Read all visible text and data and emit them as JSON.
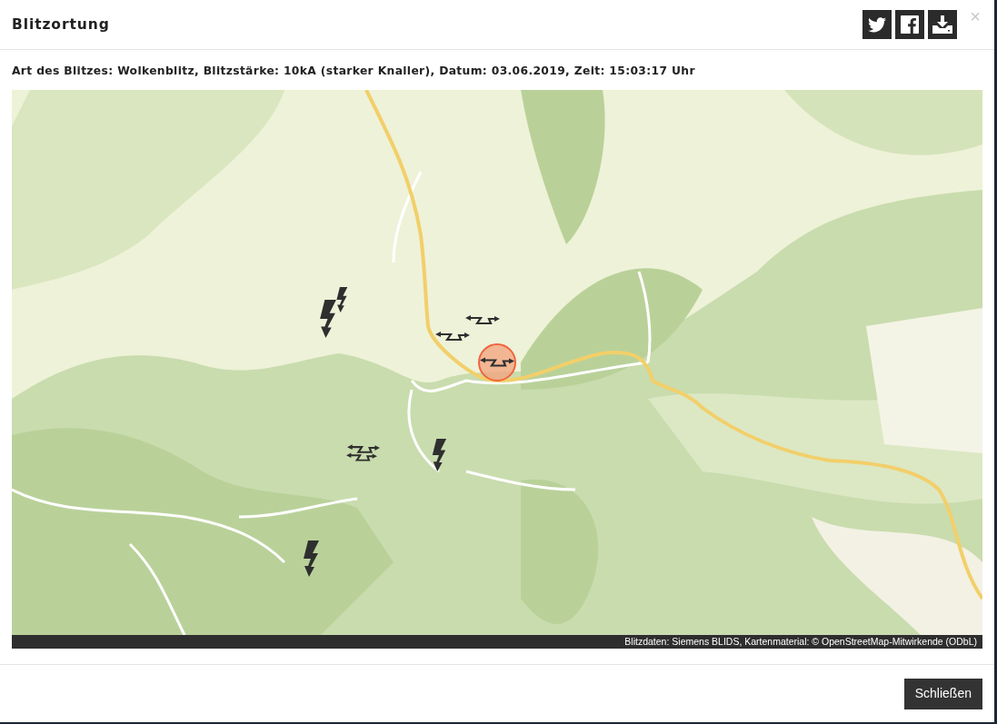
{
  "modal": {
    "title": "Blitzortung",
    "close": "×"
  },
  "share_buttons": [
    {
      "kind": "twitter"
    },
    {
      "kind": "facebook"
    },
    {
      "kind": "download"
    }
  ],
  "info": "Art des Blitzes: Wolkenblitz, Blitzstärke: 10kA (starker Knaller), Datum: 03.06.2019, Zeit: 15:03:17 Uhr",
  "map": {
    "strikes": [
      {
        "kind": "ground",
        "selected": false
      },
      {
        "kind": "ground",
        "selected": false
      },
      {
        "kind": "cloud",
        "selected": false
      },
      {
        "kind": "cloud",
        "selected": false
      },
      {
        "kind": "cloud",
        "selected": true
      },
      {
        "kind": "cloud",
        "selected": false
      },
      {
        "kind": "cloud",
        "selected": false
      },
      {
        "kind": "ground",
        "selected": false
      },
      {
        "kind": "ground",
        "selected": false
      }
    ],
    "attribution": "Blitzdaten: Siemens BLIDS, Kartenmaterial: © OpenStreetMap-Mitwirkende (ODbL)"
  },
  "footer": {
    "button": "Schließen"
  }
}
